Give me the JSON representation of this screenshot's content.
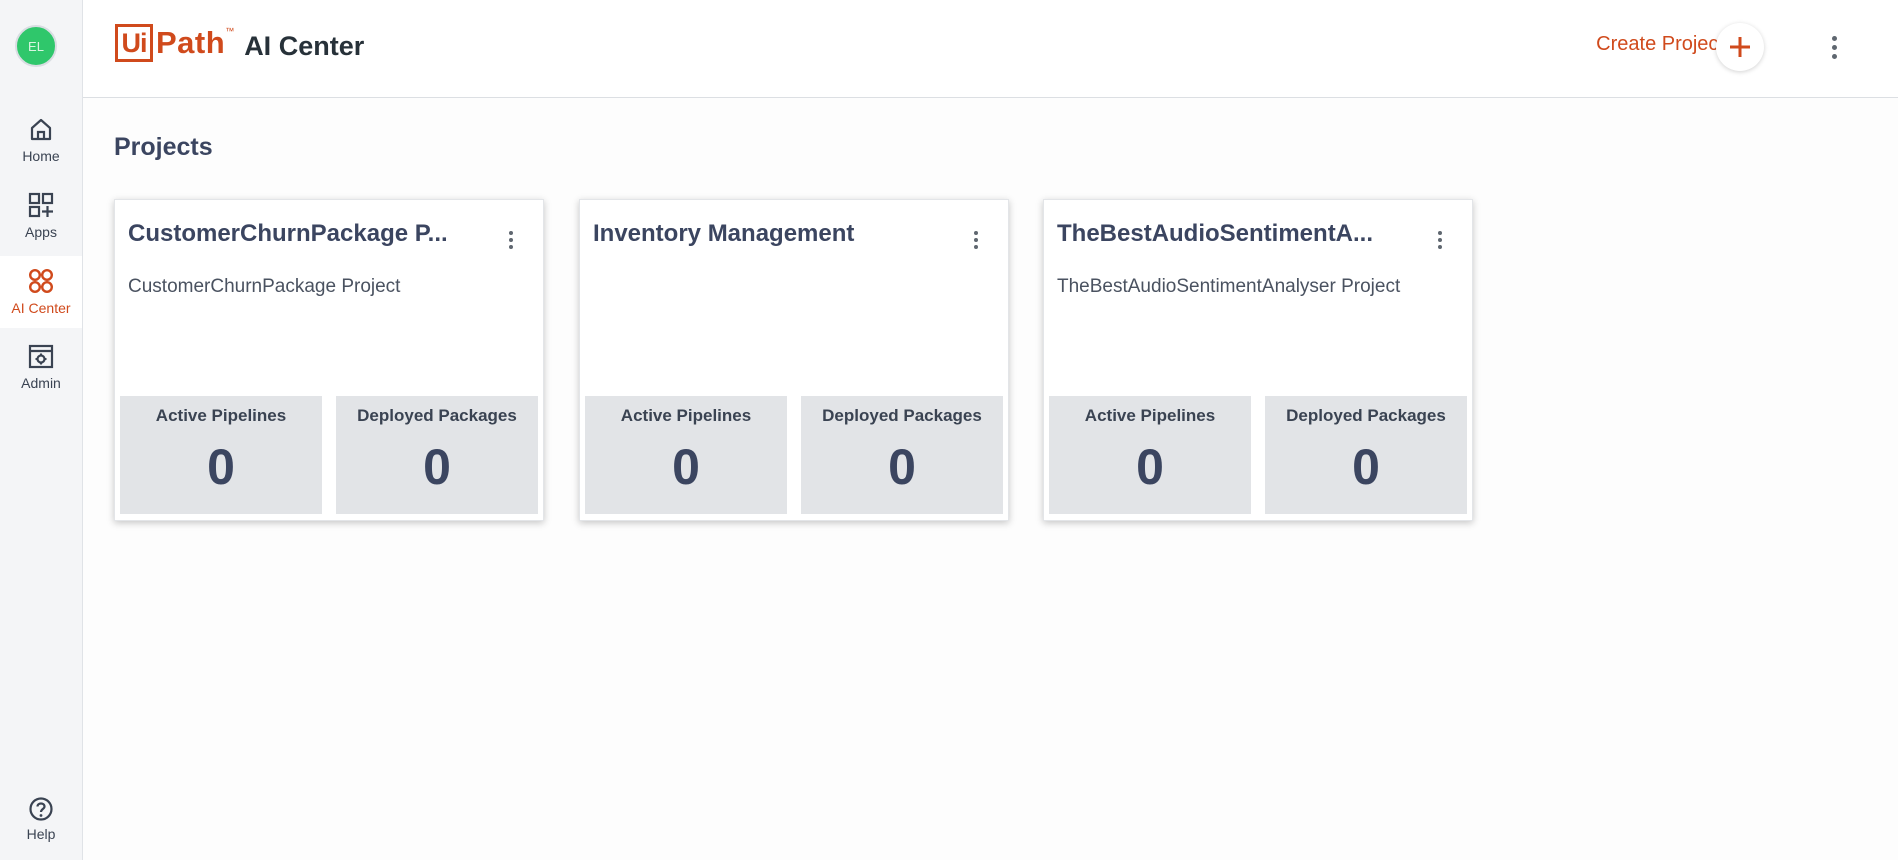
{
  "sidebar": {
    "avatar_initials": "EL",
    "items": [
      {
        "label": "Home",
        "icon": "home-icon"
      },
      {
        "label": "Apps",
        "icon": "apps-grid-icon"
      },
      {
        "label": "AI Center",
        "icon": "ai-center-icon"
      },
      {
        "label": "Admin",
        "icon": "admin-icon"
      }
    ],
    "help_label": "Help",
    "active_item": "AI Center"
  },
  "header": {
    "logo_ui": "Ui",
    "logo_path": "Path",
    "logo_tm": "™",
    "product_name": "AI Center",
    "create_project_label": "Create Project",
    "create_icon": "plus-icon",
    "menu_icon": "more-vertical-icon"
  },
  "main": {
    "title": "Projects",
    "projects": [
      {
        "title": "CustomerChurnPackage P...",
        "description": "CustomerChurnPackage Project",
        "stats": [
          {
            "label": "Active Pipelines",
            "value": "0"
          },
          {
            "label": "Deployed Packages",
            "value": "0"
          }
        ]
      },
      {
        "title": "Inventory Management",
        "description": "",
        "stats": [
          {
            "label": "Active Pipelines",
            "value": "0"
          },
          {
            "label": "Deployed Packages",
            "value": "0"
          }
        ]
      },
      {
        "title": "TheBestAudioSentimentA...",
        "description": "TheBestAudioSentimentAnalyser Project",
        "stats": [
          {
            "label": "Active Pipelines",
            "value": "0"
          },
          {
            "label": "Deployed Packages",
            "value": "0"
          }
        ]
      }
    ]
  },
  "colors": {
    "accent": "#d04a1c",
    "avatar": "#2fc76b",
    "title_text": "#3b4560",
    "stat_background": "#e2e4e7"
  }
}
